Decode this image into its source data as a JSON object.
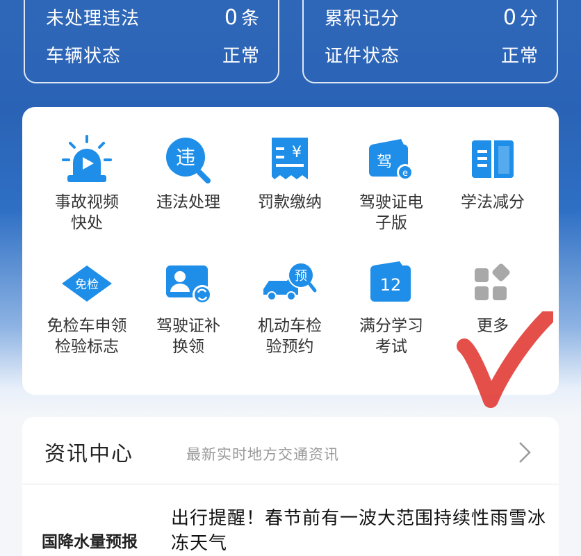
{
  "status": {
    "left": {
      "row1_label": "未处理违法",
      "row1_value": "0",
      "row1_unit": "条",
      "row2_label": "车辆状态",
      "row2_value": "正常"
    },
    "right": {
      "row1_label": "累积记分",
      "row1_value": "0",
      "row1_unit": "分",
      "row2_label": "证件状态",
      "row2_value": "正常"
    }
  },
  "services": [
    {
      "line1": "事故视频",
      "line2": "快处",
      "icon": "siren-video-icon"
    },
    {
      "line1": "违法处理",
      "line2": "",
      "icon": "violation-search-icon",
      "badge": "违"
    },
    {
      "line1": "罚款缴纳",
      "line2": "",
      "icon": "fine-receipt-icon",
      "badge": "¥"
    },
    {
      "line1": "驾驶证电",
      "line2": "子版",
      "icon": "e-license-icon",
      "badge": "驾"
    },
    {
      "line1": "学法减分",
      "line2": "",
      "icon": "open-book-icon"
    },
    {
      "line1": "免检车申领",
      "line2": "检验标志",
      "icon": "inspection-exempt-icon",
      "badge": "免检"
    },
    {
      "line1": "驾驶证补",
      "line2": "换领",
      "icon": "license-renew-icon"
    },
    {
      "line1": "机动车检",
      "line2": "验预约",
      "icon": "vehicle-inspection-booking-icon",
      "badge": "预"
    },
    {
      "line1": "满分学习",
      "line2": "考试",
      "icon": "calendar-12-icon",
      "badge": "12"
    },
    {
      "line1": "更多",
      "line2": "",
      "icon": "more-grid-icon"
    }
  ],
  "news": {
    "header": "资讯中心",
    "subtitle": "最新实时地方交通资讯",
    "title": "出行提醒！春节前有一波大范围持续性雨雪冰冻天气",
    "thumb_text": "国降水量预报"
  },
  "colors": {
    "header_blue": "#2f67b8",
    "icon_blue": "#1e8ee8",
    "more_gray": "#a8a8a8",
    "check_red": "#e0302a"
  }
}
